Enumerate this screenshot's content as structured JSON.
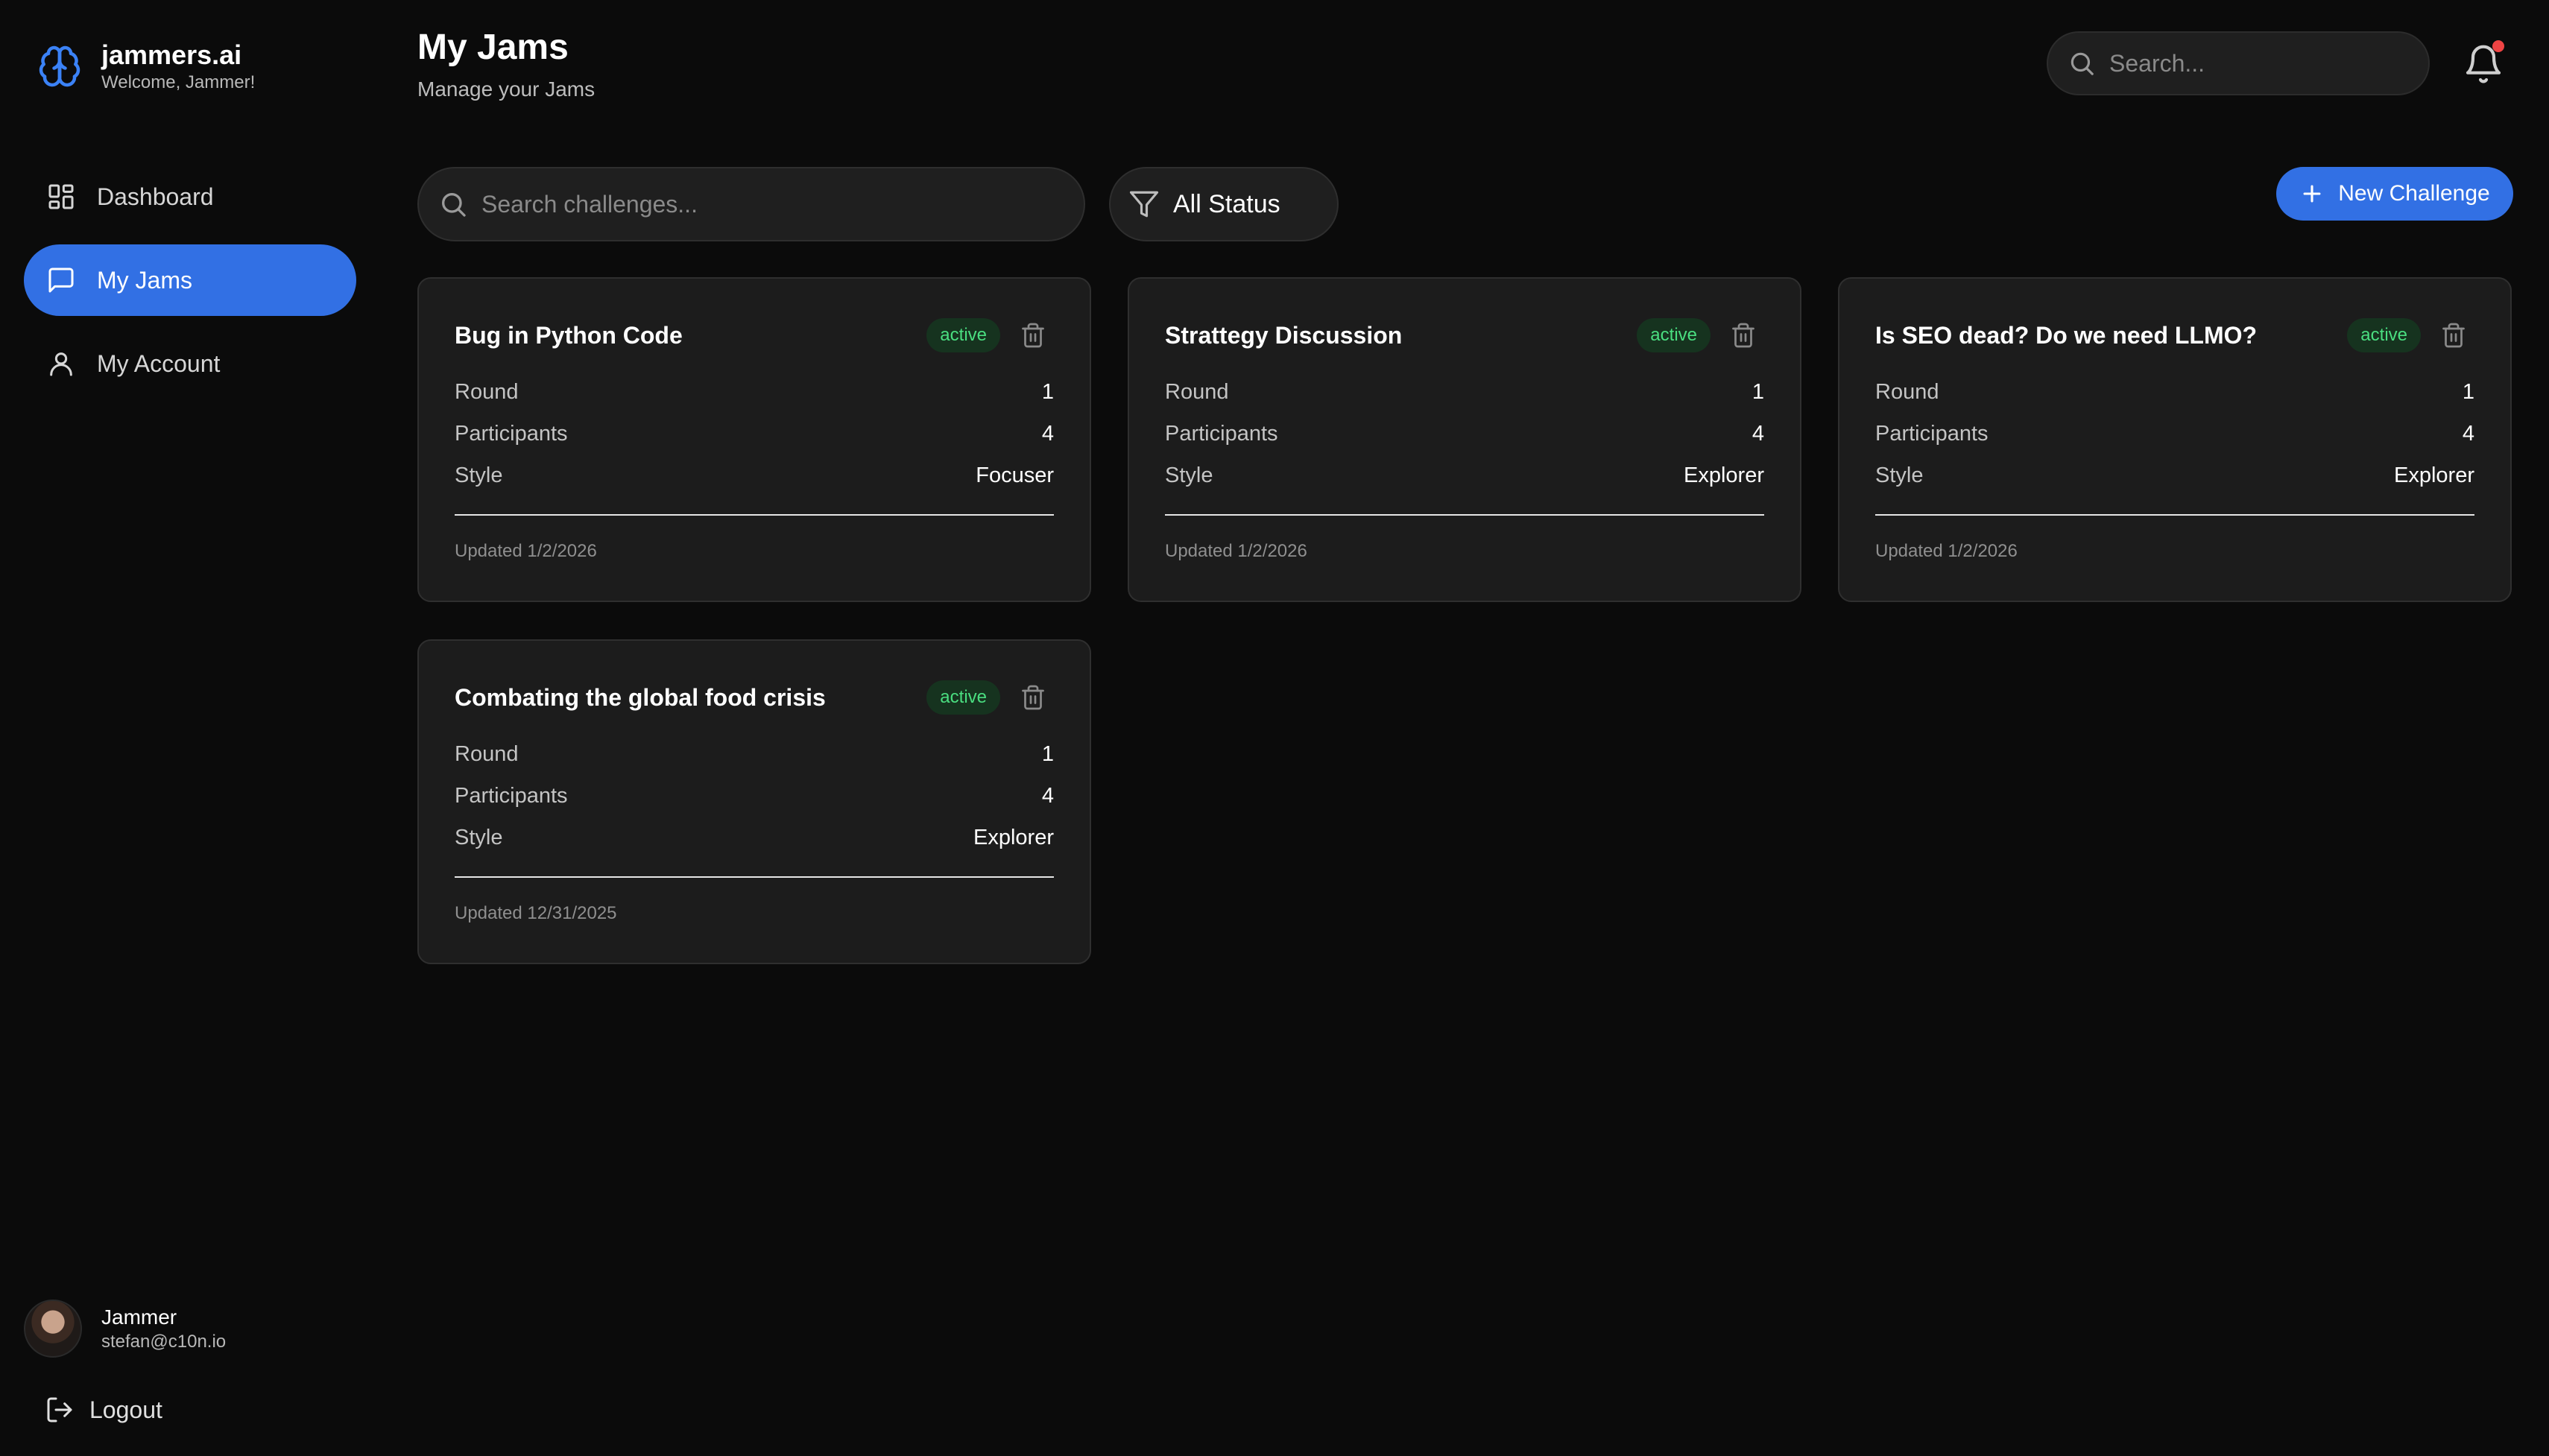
{
  "brand": {
    "name": "jammers.ai",
    "welcome": "Welcome, Jammer!"
  },
  "sidebar": {
    "items": [
      {
        "label": "Dashboard",
        "icon": "grid-icon",
        "active": false
      },
      {
        "label": "My Jams",
        "icon": "chat-icon",
        "active": true
      },
      {
        "label": "My Account",
        "icon": "user-icon",
        "active": false
      }
    ],
    "user": {
      "name": "Jammer",
      "email": "stefan@c10n.io"
    },
    "logout_label": "Logout"
  },
  "header": {
    "title": "My Jams",
    "subtitle": "Manage your Jams",
    "search_placeholder": "Search...",
    "notification_dot": true
  },
  "toolbar": {
    "search_placeholder": "Search challenges...",
    "status_filter_label": "All Status",
    "new_challenge_label": "New Challenge"
  },
  "colors": {
    "accent": "#3270e4",
    "badge_bg": "#16331f",
    "badge_text": "#4ade80",
    "notification": "#ef4444"
  },
  "cards": [
    {
      "title": "Bug in Python Code",
      "status": "active",
      "round_label": "Round",
      "round": "1",
      "participants_label": "Participants",
      "participants": "4",
      "style_label": "Style",
      "style": "Focuser",
      "updated": "Updated 1/2/2026"
    },
    {
      "title": "Strattegy Discussion",
      "status": "active",
      "round_label": "Round",
      "round": "1",
      "participants_label": "Participants",
      "participants": "4",
      "style_label": "Style",
      "style": "Explorer",
      "updated": "Updated 1/2/2026"
    },
    {
      "title": "Is SEO dead? Do we need LLMO?",
      "status": "active",
      "round_label": "Round",
      "round": "1",
      "participants_label": "Participants",
      "participants": "4",
      "style_label": "Style",
      "style": "Explorer",
      "updated": "Updated 1/2/2026"
    },
    {
      "title": "Combating the global food crisis",
      "status": "active",
      "round_label": "Round",
      "round": "1",
      "participants_label": "Participants",
      "participants": "4",
      "style_label": "Style",
      "style": "Explorer",
      "updated": "Updated 12/31/2025"
    }
  ]
}
